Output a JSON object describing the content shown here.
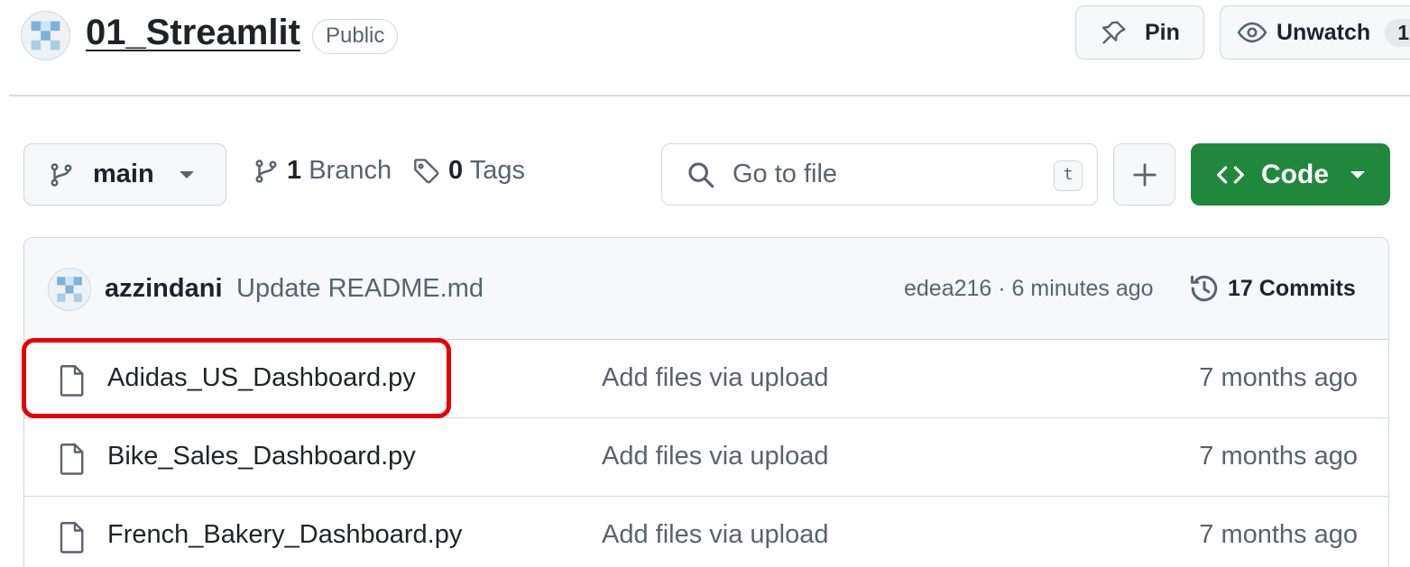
{
  "repo": {
    "name": "01_Streamlit",
    "visibility": "Public"
  },
  "header_buttons": {
    "pin_label": "Pin",
    "unwatch_label": "Unwatch",
    "watch_count": "1"
  },
  "toolbar": {
    "branch": "main",
    "branch_count": "1",
    "branch_text": "Branch",
    "tag_count": "0",
    "tag_text": "Tags",
    "search_placeholder": "Go to file",
    "search_shortcut": "t",
    "code_label": "Code"
  },
  "latest_commit": {
    "author": "azzindani",
    "message": "Update README.md",
    "meta": "edea216 · 6 minutes ago",
    "commits_count": "17",
    "commits_text": "Commits"
  },
  "files": [
    {
      "name": "Adidas_US_Dashboard.py",
      "message": "Add files via upload",
      "date": "7 months ago"
    },
    {
      "name": "Bike_Sales_Dashboard.py",
      "message": "Add files via upload",
      "date": "7 months ago"
    },
    {
      "name": "French_Bakery_Dashboard.py",
      "message": "Add files via upload",
      "date": "7 months ago"
    }
  ],
  "colors": {
    "accent_green": "#1f883d",
    "highlight_red": "#e60000"
  }
}
